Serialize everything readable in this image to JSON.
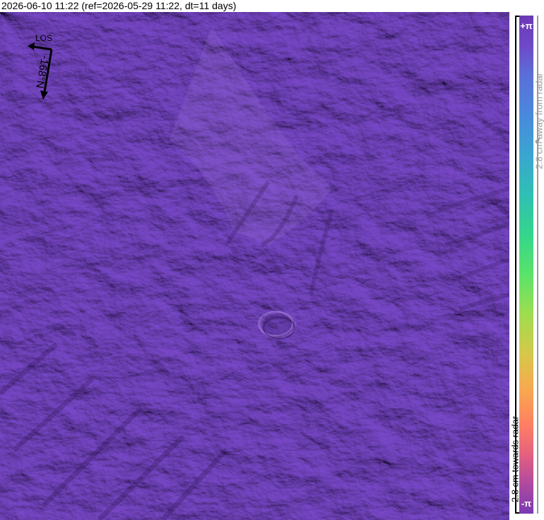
{
  "title": "2026-06-10 11:22 (ref=2026-05-29 11:22, dt=11 days)",
  "map": {
    "base_color": "#6e3fb8",
    "compass": {
      "los_label": "LOS",
      "heading_label": "-168°N",
      "arrow_icon": "los-arrow"
    }
  },
  "colorbar": {
    "top_symbol": "+π",
    "bottom_symbol": "-π",
    "away_label": "2.8 cm away from radar",
    "towards_label": "2.8 cm towards radar",
    "colors": [
      "#6b38b5",
      "#5b6fd8",
      "#3aa6d0",
      "#34d58c",
      "#9edd4f",
      "#f7a94f",
      "#ff8062",
      "#b04aa0"
    ]
  }
}
